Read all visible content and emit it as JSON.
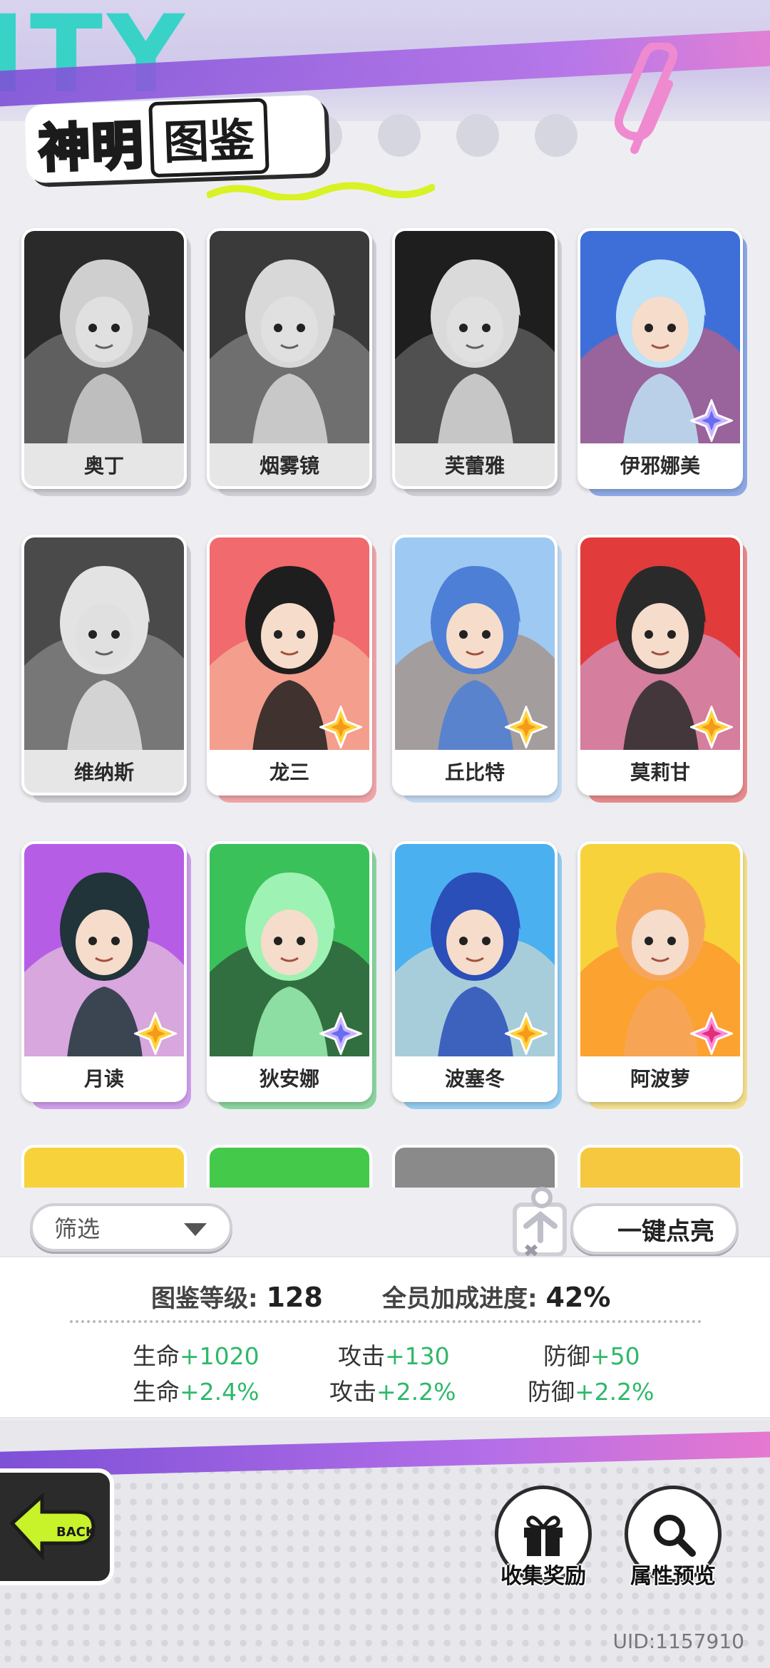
{
  "header": {
    "title_part1": "神明",
    "title_part2": "图鉴"
  },
  "cards": [
    {
      "name": "奥丁",
      "locked": true,
      "palette": [
        "#2a2a2a",
        "#cfcfcf",
        "#8a8a8a"
      ],
      "badge": ""
    },
    {
      "name": "烟雾镜",
      "locked": true,
      "palette": [
        "#3a3a3a",
        "#d8d8d8",
        "#9a9a9a"
      ],
      "badge": ""
    },
    {
      "name": "芙蕾雅",
      "locked": true,
      "palette": [
        "#1e1e1e",
        "#dadada",
        "#7a7a7a"
      ],
      "badge": ""
    },
    {
      "name": "伊邪娜美",
      "locked": false,
      "palette": [
        "#3e6fd8",
        "#bfe3f7",
        "#e45a6a"
      ],
      "badge": "purple"
    },
    {
      "name": "维纳斯",
      "locked": true,
      "palette": [
        "#4a4a4a",
        "#e3e3e3",
        "#9c9c9c"
      ],
      "badge": ""
    },
    {
      "name": "龙三",
      "locked": false,
      "palette": [
        "#f06a6e",
        "#1e1e1e",
        "#f8c9a8"
      ],
      "badge": "gold"
    },
    {
      "name": "丘比特",
      "locked": false,
      "palette": [
        "#9ec9f2",
        "#4d7fd6",
        "#a7785a"
      ],
      "badge": "gold"
    },
    {
      "name": "莫莉甘",
      "locked": false,
      "palette": [
        "#e23b3b",
        "#2a2a2a",
        "#cbb7f0"
      ],
      "badge": "gold"
    },
    {
      "name": "月读",
      "locked": false,
      "palette": [
        "#b65de6",
        "#20343a",
        "#f3e4d6"
      ],
      "badge": "gold"
    },
    {
      "name": "狄安娜",
      "locked": false,
      "palette": [
        "#3bc15a",
        "#9ef2b4",
        "#2b2b2b"
      ],
      "badge": "purple"
    },
    {
      "name": "波塞冬",
      "locked": false,
      "palette": [
        "#4bb0f0",
        "#2a4fb8",
        "#f4e6c8"
      ],
      "badge": "gold"
    },
    {
      "name": "阿波萝",
      "locked": false,
      "palette": [
        "#f7d23a",
        "#f6a65c",
        "#ff7a2a"
      ],
      "badge": "pink"
    }
  ],
  "filter": {
    "label": "筛选",
    "light_all": "一键点亮"
  },
  "info": {
    "level_label": "图鉴等级:",
    "level_value": "128",
    "progress_label": "全员加成进度:",
    "progress_value": "42%",
    "stats": [
      {
        "label": "生命",
        "value": "+1020"
      },
      {
        "label": "攻击",
        "value": "+130"
      },
      {
        "label": "防御",
        "value": "+50"
      },
      {
        "label": "生命",
        "value": "+2.4%"
      },
      {
        "label": "攻击",
        "value": "+2.2%"
      },
      {
        "label": "防御",
        "value": "+2.2%"
      }
    ]
  },
  "footer": {
    "back_label": "BACK",
    "reward_label": "收集奖励",
    "preview_label": "属性预览",
    "uid": "UID:1157910"
  },
  "colors": {
    "accent_purple": "#7b4fd6",
    "accent_pink": "#f07acb",
    "accent_teal": "#29d3c4",
    "stat_green": "#2fb86b",
    "title_yellow": "#f5e224"
  }
}
